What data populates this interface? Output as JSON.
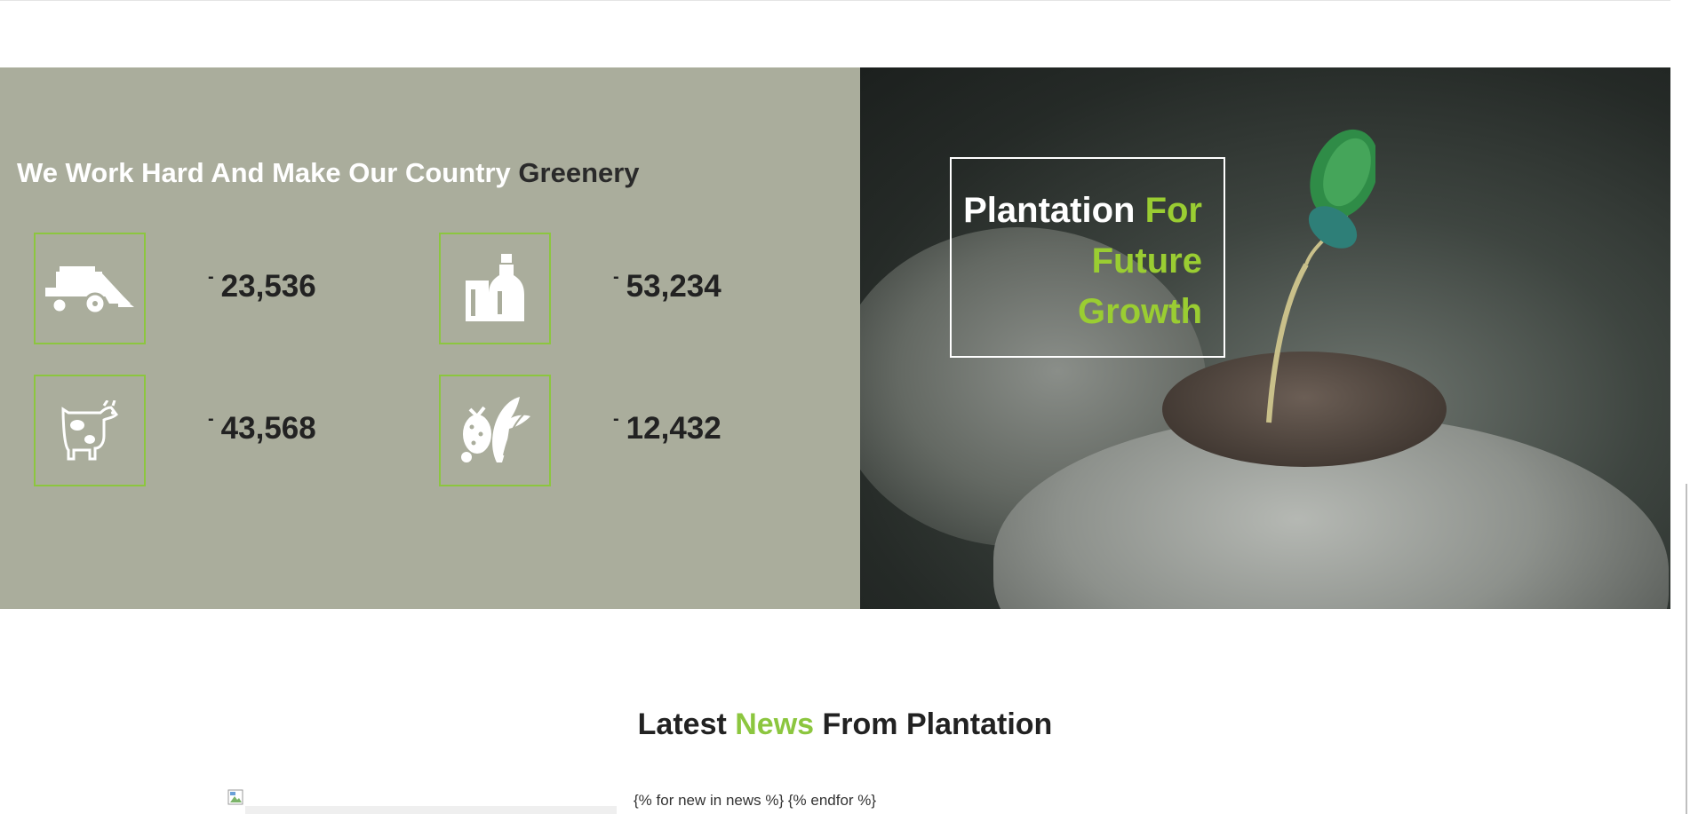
{
  "stats_section": {
    "title_light": "We Work Hard And Make Our Country",
    "title_dark": "Greenery",
    "items": [
      {
        "icon": "harvester-icon",
        "dash": "-",
        "value": "23,536"
      },
      {
        "icon": "milk-bottle-icon",
        "dash": "-",
        "value": "53,234"
      },
      {
        "icon": "cow-icon",
        "dash": "-",
        "value": "43,568"
      },
      {
        "icon": "vegetables-icon",
        "dash": "-",
        "value": "12,432"
      }
    ],
    "accent_color": "#8cc63f",
    "background_color": "#aaad9c"
  },
  "hero": {
    "image": "hands-holding-sprout",
    "heading_plain": "Plantation",
    "heading_accent_1": "For",
    "heading_accent_2": "Future",
    "heading_accent_3": "Growth",
    "accent_color": "#9acd32"
  },
  "news": {
    "title_pre": "Latest",
    "title_accent": "News",
    "title_post": "From Plantation",
    "template_text": "{% for new in news %} {% endfor %}"
  }
}
